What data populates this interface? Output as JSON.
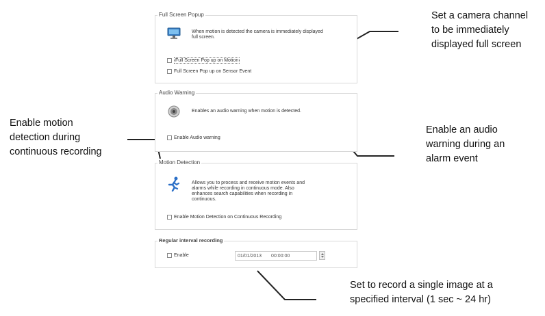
{
  "full_screen_popup": {
    "title": "Full Screen Popup",
    "description": "When motion is detected the camera is immediately displayed full screen.",
    "options": [
      "Full Screen Pop up on Motion",
      "Full Screen Pop up on Sensor Event"
    ],
    "icon": "monitor-icon"
  },
  "audio_warning": {
    "title": "Audio Warning",
    "description": "Enables an audio warning when motion is detected.",
    "option": "Enable Audio warning",
    "icon": "speaker-icon"
  },
  "motion_detection": {
    "title": "Motion Detection",
    "description_lines": [
      "Allows you to process and receive motion events and",
      "alarms while recording in continuous mode. Also",
      "enhances search capabilities when recording in",
      "continuous."
    ],
    "option": "Enable Motion Detection on Continuous Recording",
    "icon": "running-man-icon"
  },
  "regular_interval": {
    "title": "Regular interval recording",
    "option": "Enable",
    "date_value": "01/01/2013",
    "time_value": "00:00:00"
  },
  "annotations": {
    "camera_channel": [
      "Set a camera channel",
      "to be immediately",
      "displayed full screen"
    ],
    "audio": [
      "Enable an audio",
      "warning during an",
      "alarm event"
    ],
    "motion": [
      "Enable motion",
      "detection during",
      "continuous recording"
    ],
    "interval": [
      "Set to record a single image at a",
      "specified interval (1 sec ~ 24 hr)"
    ]
  }
}
